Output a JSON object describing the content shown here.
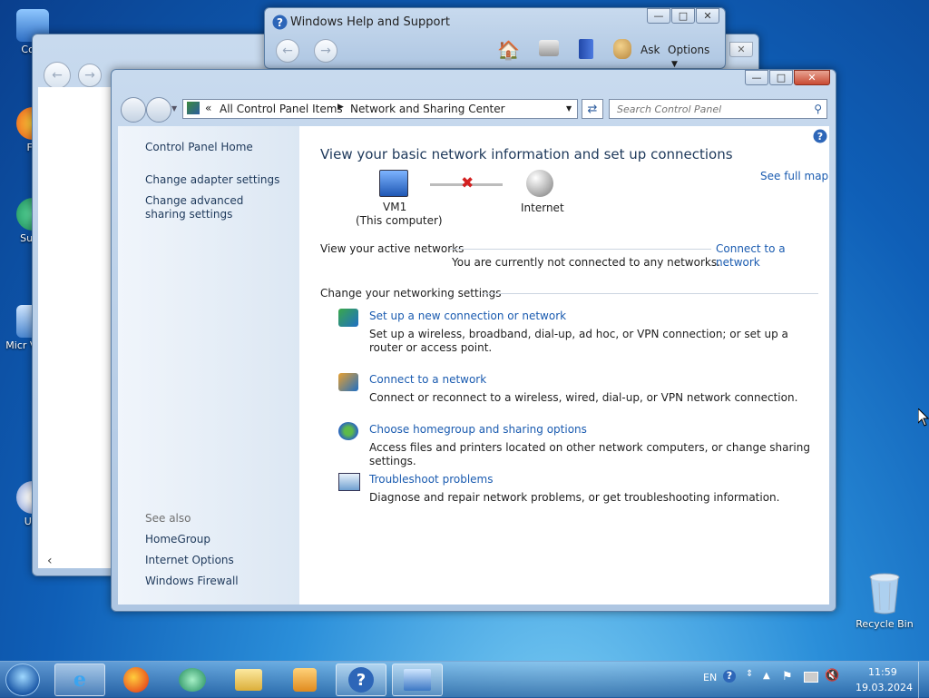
{
  "desktop": {
    "icons": [
      {
        "label": "Com"
      },
      {
        "label": "Fir"
      },
      {
        "label": "Supe"
      },
      {
        "label": "Micr Visual"
      },
      {
        "label": "Ulti"
      }
    ],
    "recycle_bin": "Recycle Bin"
  },
  "help_window": {
    "title": "Windows Help and Support",
    "ask": "Ask",
    "options": "Options"
  },
  "control_panel": {
    "breadcrumb": [
      "All Control Panel Items",
      "Network and Sharing Center"
    ],
    "search_placeholder": "Search Control Panel",
    "left_pane": {
      "home": "Control Panel Home",
      "links": [
        "Change adapter settings",
        "Change advanced sharing settings"
      ],
      "see_also_title": "See also",
      "see_also": [
        "HomeGroup",
        "Internet Options",
        "Windows Firewall"
      ]
    },
    "main": {
      "heading": "View your basic network information and set up connections",
      "see_full_map": "See full map",
      "computer_name": "VM1",
      "computer_sub": "(This computer)",
      "internet": "Internet",
      "active_networks_label": "View your active networks",
      "connect_link": "Connect to a network",
      "not_connected": "You are currently not connected to any networks.",
      "settings_label": "Change your networking settings",
      "tasks": [
        {
          "title": "Set up a new connection or network",
          "desc": "Set up a wireless, broadband, dial-up, ad hoc, or VPN connection; or set up a router or access point."
        },
        {
          "title": "Connect to a network",
          "desc": "Connect or reconnect to a wireless, wired, dial-up, or VPN network connection."
        },
        {
          "title": "Choose homegroup and sharing options",
          "desc": "Access files and printers located on other network computers, or change sharing settings."
        },
        {
          "title": "Troubleshoot problems",
          "desc": "Diagnose and repair network problems, or get troubleshooting information."
        }
      ]
    }
  },
  "taskbar": {
    "language": "EN",
    "time": "11:59",
    "date": "19.03.2024"
  }
}
